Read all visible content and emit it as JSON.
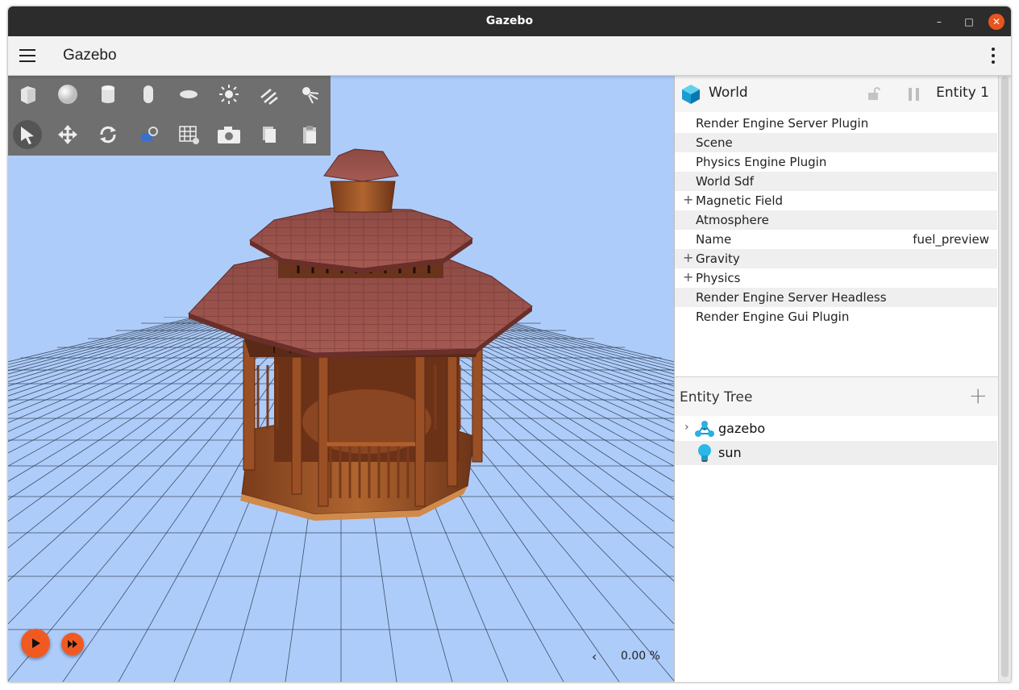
{
  "window": {
    "title": "Gazebo",
    "controls": {
      "minimize": "–",
      "maximize": "□",
      "close": "✕"
    }
  },
  "appbar": {
    "title": "Gazebo"
  },
  "toolbar": {
    "row1": [
      "box-icon",
      "sphere-icon",
      "cylinder-icon",
      "capsule-icon",
      "ellipsoid-icon",
      "point-light-icon",
      "directional-light-icon",
      "spot-light-icon"
    ],
    "row2": [
      "select-icon",
      "translate-icon",
      "rotate-icon",
      "transform-control-icon",
      "grid-config-icon",
      "screenshot-icon",
      "copy-icon",
      "paste-icon"
    ]
  },
  "viewport": {
    "rtf_chevron": "‹",
    "rtf": "0.00 %"
  },
  "component_inspector": {
    "title": "World",
    "entity": "Entity 1",
    "properties": [
      {
        "label": "Render Engine Server Plugin",
        "expandable": false,
        "value": ""
      },
      {
        "label": "Scene",
        "expandable": false,
        "value": ""
      },
      {
        "label": "Physics Engine Plugin",
        "expandable": false,
        "value": ""
      },
      {
        "label": "World Sdf",
        "expandable": false,
        "value": ""
      },
      {
        "label": "Magnetic Field",
        "expandable": true,
        "value": ""
      },
      {
        "label": "Atmosphere",
        "expandable": false,
        "value": ""
      },
      {
        "label": "Name",
        "expandable": false,
        "value": "fuel_preview"
      },
      {
        "label": "Gravity",
        "expandable": true,
        "value": ""
      },
      {
        "label": "Physics",
        "expandable": true,
        "value": ""
      },
      {
        "label": "Render Engine Server Headless",
        "expandable": false,
        "value": ""
      },
      {
        "label": "Render Engine Gui Plugin",
        "expandable": false,
        "value": ""
      }
    ],
    "plus_glyph": "+"
  },
  "entity_tree": {
    "title": "Entity Tree",
    "add": "+",
    "items": [
      {
        "label": "gazebo",
        "icon": "model-icon",
        "expandable": true,
        "chevron": "›"
      },
      {
        "label": "sun",
        "icon": "light-bulb-icon",
        "expandable": false,
        "chevron": ""
      }
    ]
  },
  "colors": {
    "sky": "#aeccfa",
    "accent": "#f05a22",
    "toolbar": "#6f6f6f",
    "roof": "#8e4a42",
    "wood": "#a0562a"
  }
}
